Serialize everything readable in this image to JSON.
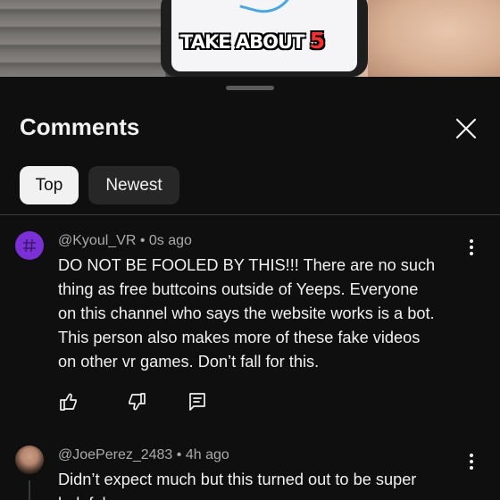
{
  "video": {
    "caption_main": "TAKE ABOUT",
    "caption_highlight": "5",
    "highlight_color": "#ff2d2d"
  },
  "panel": {
    "title": "Comments",
    "close_icon": "close-icon"
  },
  "sort_chips": [
    {
      "label": "Top",
      "selected": true
    },
    {
      "label": "Newest",
      "selected": false
    }
  ],
  "comments": [
    {
      "handle": "@Kyoul_VR",
      "age": "0s ago",
      "avatar_color": "#7b2fd6",
      "lines": [
        "DO NOT BE FOOLED BY THIS!!! There are no such",
        "thing as free buttcoins outside of Yeeps. Everyone",
        "on this channel who says the website works is a bot.",
        "This person also makes more of these fake videos",
        "on other vr games. Don’t fall for this."
      ],
      "actions": [
        "thumbs-up-icon",
        "thumbs-down-icon",
        "reply-icon"
      ]
    },
    {
      "handle": "@JoePerez_2483",
      "age": "4h ago",
      "lines": [
        "Didn’t expect much but this turned out to be super",
        "helpful"
      ]
    }
  ],
  "separator": "•",
  "colors": {
    "background": "#0f0f0f",
    "text": "#f1f1f1",
    "secondary_text": "#aaaaaa",
    "chip_bg": "#272727"
  }
}
